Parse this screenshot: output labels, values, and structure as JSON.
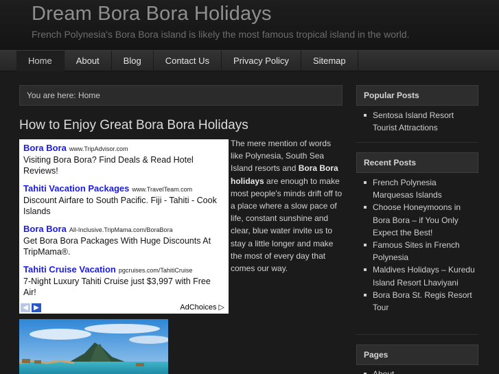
{
  "site": {
    "title": "Dream Bora Bora Holidays",
    "description": "French Polynesia's Bora Bora island is likely the most famous tropical island in the world."
  },
  "nav": {
    "items": [
      "Home",
      "About",
      "Blog",
      "Contact Us",
      "Privacy Policy",
      "Sitemap"
    ],
    "active": "Home"
  },
  "breadcrumb": {
    "prefix": "You are here:",
    "current": "Home"
  },
  "post": {
    "title": "How to Enjoy Great Bora Bora Holidays",
    "text_1": "The mere mention of words like Polynesia, South Sea Island resorts and ",
    "text_bold": "Bora Bora holidays",
    "text_2": " are enough to make most people's minds drift off to a place where a slow pace of life, constant sunshine and clear, blue water invite us to stay a little longer and make the most of every day that comes our way."
  },
  "ads": {
    "items": [
      {
        "title": "Bora Bora",
        "url": "www.TripAdvisor.com",
        "desc": "Visiting Bora Bora? Find Deals & Read Hotel Reviews!"
      },
      {
        "title": "Tahiti Vacation Packages",
        "url": "www.TravelTeam.com",
        "desc": "Discount Airfare to South Pacific. Fiji - Tahiti - Cook Islands"
      },
      {
        "title": "Bora Bora",
        "url": "All-Inclusive.TripMama.com/BoraBora",
        "desc": "Get Bora Bora Packages With Huge Discounts At TripMama®."
      },
      {
        "title": "Tahiti Cruise Vacation",
        "url": "pgcruises.com/TahitiCruise",
        "desc": "7-Night Luxury Tahiti Cruise just $3,997 with Free Air!"
      }
    ],
    "adchoices": "AdChoices"
  },
  "sidebar": {
    "popular": {
      "heading": "Popular Posts",
      "items": [
        "Sentosa Island Resort Tourist Attractions"
      ]
    },
    "recent": {
      "heading": "Recent Posts",
      "items": [
        "French Polynesia Marquesas Islands",
        "Choose Honeymoons in Bora Bora – if You Only Expect the Best!",
        "Famous Sites in French Polynesia",
        "Maldives Holidays – Kuredu Island Resort Lhaviyani",
        "Bora Bora St. Regis Resort Tour"
      ]
    },
    "pages": {
      "heading": "Pages",
      "items": [
        "About"
      ]
    }
  },
  "colors": {
    "background": "#1b1b1b",
    "ad_link": "#1a1ae6",
    "nav_bar": "#2c2c2c"
  }
}
